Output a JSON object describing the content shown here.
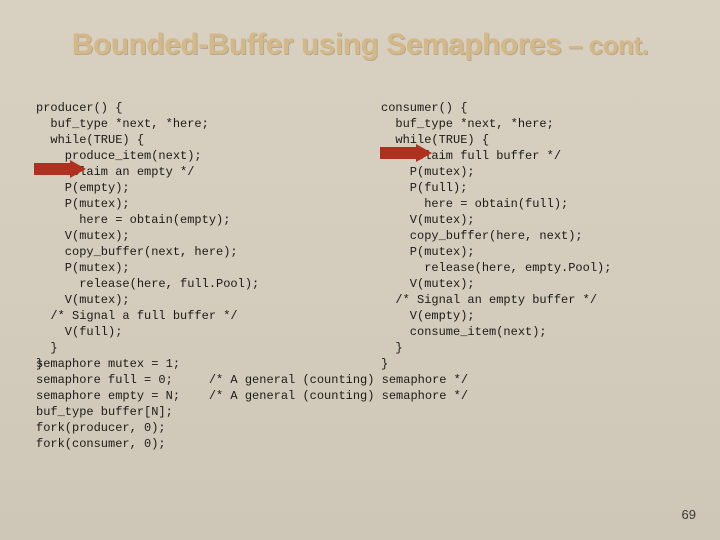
{
  "title_main": "Bounded-Buffer using Semaphores",
  "title_suffix": " – cont.",
  "producer_code": "producer() {\n  buf_type *next, *here;\n  while(TRUE) {\n    produce_item(next);\n  /* Claim an empty */\n    P(empty);\n    P(mutex);\n      here = obtain(empty);\n    V(mutex);\n    copy_buffer(next, here);\n    P(mutex);\n      release(here, full.Pool);\n    V(mutex);\n  /* Signal a full buffer */\n    V(full);\n  }\n}",
  "consumer_code": "consumer() {\n  buf_type *next, *here;\n  while(TRUE) {\n  /* Claim full buffer */\n    P(mutex);\n    P(full);\n      here = obtain(full);\n    V(mutex);\n    copy_buffer(here, next);\n    P(mutex);\n      release(here, empty.Pool);\n    V(mutex);\n  /* Signal an empty buffer */\n    V(empty);\n    consume_item(next);\n  }\n}",
  "bottom_code": "semaphore mutex = 1;\nsemaphore full = 0;     /* A general (counting) semaphore */\nsemaphore empty = N;    /* A general (counting) semaphore */\nbuf_type buffer[N];\nfork(producer, 0);\nfork(consumer, 0);",
  "page_number": "69"
}
